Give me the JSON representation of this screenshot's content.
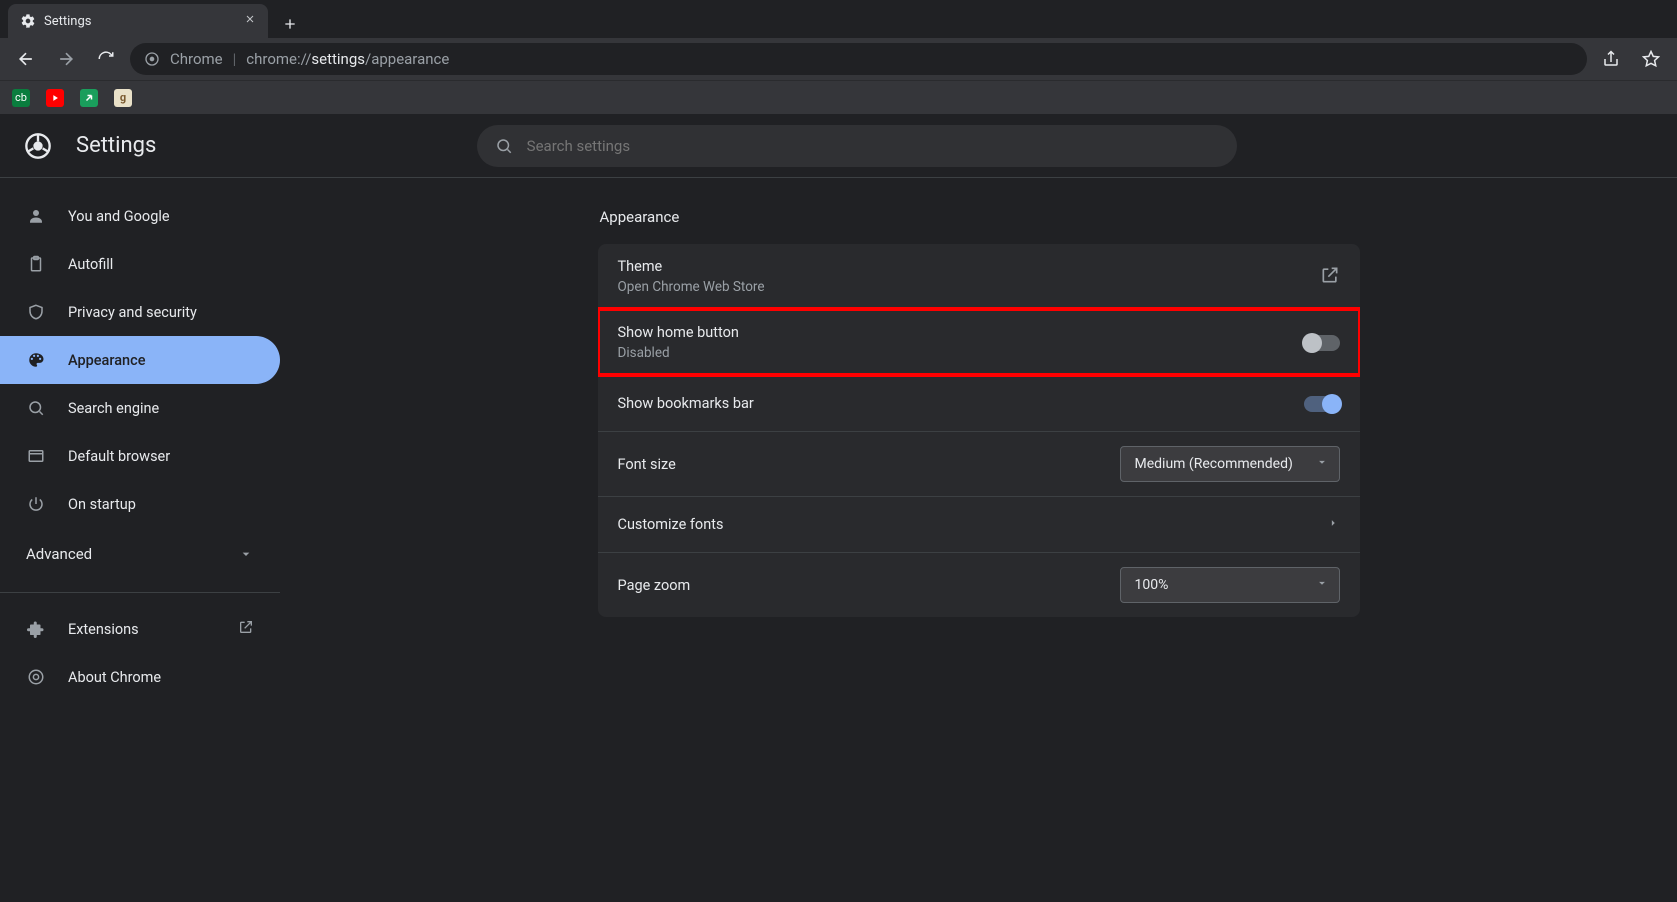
{
  "tab": {
    "title": "Settings"
  },
  "omnibox": {
    "host": "Chrome",
    "url_prefix": "chrome://",
    "url_bold": "settings",
    "url_suffix": "/appearance"
  },
  "header": {
    "title": "Settings"
  },
  "search": {
    "placeholder": "Search settings"
  },
  "sidebar": {
    "items": [
      {
        "label": "You and Google"
      },
      {
        "label": "Autofill"
      },
      {
        "label": "Privacy and security"
      },
      {
        "label": "Appearance"
      },
      {
        "label": "Search engine"
      },
      {
        "label": "Default browser"
      },
      {
        "label": "On startup"
      }
    ],
    "advanced": "Advanced",
    "footer": [
      {
        "label": "Extensions"
      },
      {
        "label": "About Chrome"
      }
    ]
  },
  "main": {
    "section_title": "Appearance",
    "theme": {
      "title": "Theme",
      "subtitle": "Open Chrome Web Store"
    },
    "home_button": {
      "title": "Show home button",
      "subtitle": "Disabled",
      "enabled": false
    },
    "bookmarks_bar": {
      "title": "Show bookmarks bar",
      "enabled": true
    },
    "font_size": {
      "title": "Font size",
      "value": "Medium (Recommended)"
    },
    "customize_fonts": {
      "title": "Customize fonts"
    },
    "page_zoom": {
      "title": "Page zoom",
      "value": "100%"
    }
  }
}
